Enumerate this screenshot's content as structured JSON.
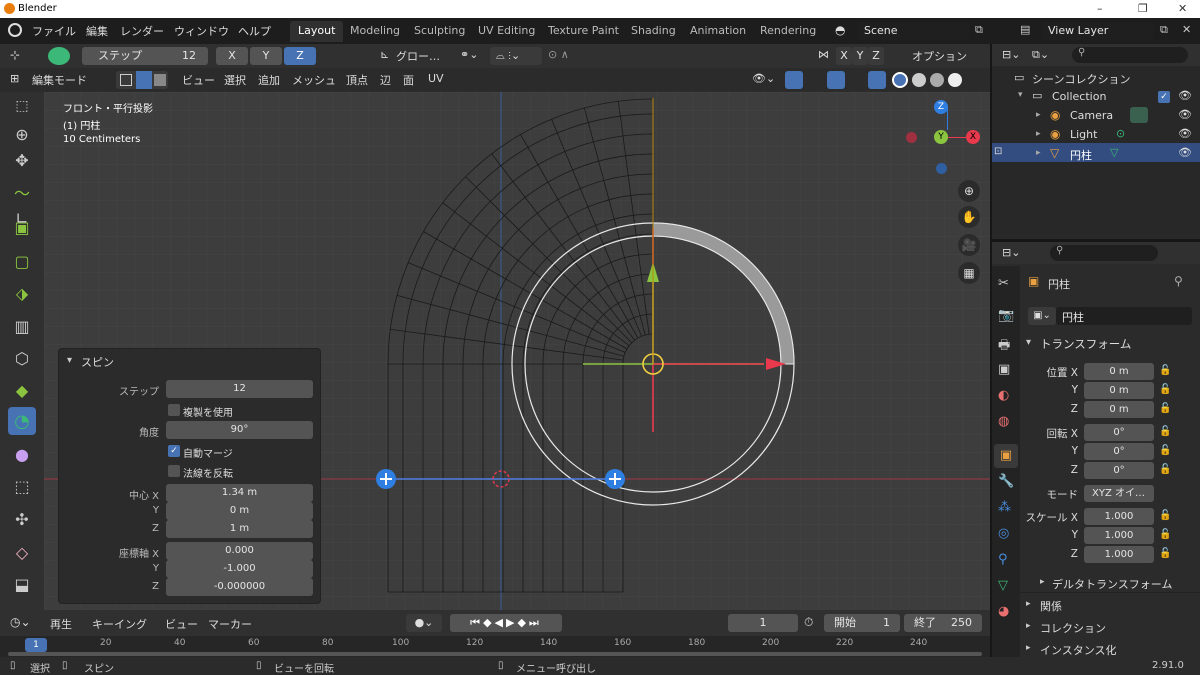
{
  "window": {
    "title": "Blender",
    "min": "–",
    "max": "❐",
    "close": "✕"
  },
  "menus": [
    "ファイル",
    "編集",
    "レンダー",
    "ウィンドウ",
    "ヘルプ"
  ],
  "workspaces": [
    "Layout",
    "Modeling",
    "Sculpting",
    "UV Editing",
    "Texture Paint",
    "Shading",
    "Animation",
    "Rendering"
  ],
  "scene": {
    "name": "Scene",
    "view_layer": "View Layer"
  },
  "tool_header": {
    "step_label": "ステップ",
    "step_value": "12",
    "axes": [
      "X",
      "Y",
      "Z"
    ],
    "active_axis": "Z",
    "orientation": "グロー…",
    "options": "オプション"
  },
  "view_header": {
    "mode": "編集モード",
    "menus": [
      "ビュー",
      "選択",
      "追加",
      "メッシュ",
      "頂点",
      "辺",
      "面",
      "UV"
    ]
  },
  "viewport": {
    "projection": "フロント・平行投影",
    "object": "(1) 円柱",
    "scale": "10 Centimeters"
  },
  "gizmo": {
    "z": "Z",
    "y": "Y",
    "x": "X"
  },
  "spin_panel": {
    "title": "スピン",
    "step_label": "ステップ",
    "step_value": "12",
    "dupli_label": "複製を使用",
    "angle_label": "角度",
    "angle_value": "90°",
    "automerge_label": "自動マージ",
    "flip_label": "法線を反転",
    "center_label_x": "中心 X",
    "center_x": "1.34 m",
    "center_label_y": "Y",
    "center_y": "0 m",
    "center_label_z": "Z",
    "center_z": "1 m",
    "axis_label_x": "座標軸 X",
    "axis_x": "0.000",
    "axis_label_y": "Y",
    "axis_y": "-1.000",
    "axis_label_z": "Z",
    "axis_z": "-0.000000"
  },
  "outliner": {
    "root": "シーンコレクション",
    "collection": "Collection",
    "items": [
      "Camera",
      "Light",
      "円柱"
    ]
  },
  "properties": {
    "object_name": "円柱",
    "data_name": "円柱",
    "transform_title": "トランスフォーム",
    "loc_label": "位置 X",
    "loc": [
      "0 m",
      "0 m",
      "0 m"
    ],
    "rot_label": "回転 X",
    "rot": [
      "0°",
      "0°",
      "0°"
    ],
    "mode_label": "モード",
    "mode": "XYZ オイ…",
    "scale_label": "スケール X",
    "scale": [
      "1.000",
      "1.000",
      "1.000"
    ],
    "axis_y": "Y",
    "axis_z": "Z",
    "delta": "デルタトランスフォーム",
    "relations": "関係",
    "collections": "コレクション",
    "instancing": "インスタンス化"
  },
  "timeline": {
    "menus": [
      "再生",
      "キーイング",
      "ビュー",
      "マーカー"
    ],
    "current_frame": "1",
    "start_label": "開始",
    "start": "1",
    "end_label": "終了",
    "end": "250",
    "ticks": [
      "1",
      "20",
      "40",
      "60",
      "80",
      "100",
      "120",
      "140",
      "160",
      "180",
      "200",
      "220",
      "240"
    ]
  },
  "status": {
    "select": "選択",
    "spin": "スピン",
    "rotate_view": "ビューを回転",
    "menu": "メニュー呼び出し",
    "version": "2.91.0"
  },
  "colors": {
    "accent": "#4772b3",
    "header": "#303030",
    "viewport": "#3d3d3d",
    "x_axis": "#e8394d",
    "y_axis": "#8bc53f",
    "z_axis": "#2f7fe3"
  }
}
